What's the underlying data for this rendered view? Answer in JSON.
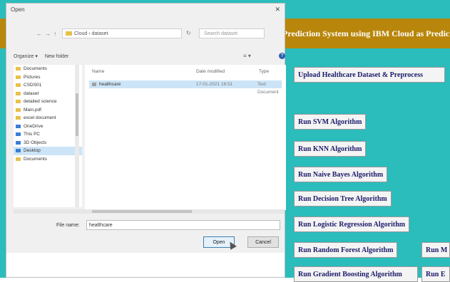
{
  "app": {
    "banner_title": "Prediction System using IBM Cloud as Prediction",
    "buttons": [
      "Upload Healthcare Dataset & Preprocess",
      "Run SVM Algorithm",
      "Run KNN Algorithm",
      "Run Naive Bayes Algorithm",
      "Run Decision Tree Algorithm",
      "Run Logistic Regression Algorithm",
      "Run Random Forest Algorithm",
      "Run Gradient Boosting Algorithm",
      "Run M",
      "Run E"
    ],
    "colors": {
      "banner": "#b8860b",
      "background": "#2bbcbc"
    }
  },
  "dialog": {
    "title": "Open",
    "close": "✕",
    "nav_back": "←",
    "nav_forward": "→",
    "nav_up": "↑",
    "address_path": "Cloud › dataset",
    "search_placeholder": "Search dataset",
    "toolbar": {
      "organize": "Organize ▾",
      "new_folder": "New folder"
    },
    "view_options": "≡ ▾",
    "help": "?",
    "nav_items": [
      {
        "label": "Documents",
        "icon": "folder-icon"
      },
      {
        "label": "Pictures",
        "icon": "folder-icon"
      },
      {
        "label": "CSDS01",
        "icon": "folder-icon"
      },
      {
        "label": "dataset",
        "icon": "folder-icon"
      },
      {
        "label": "detailed science",
        "icon": "folder-icon"
      },
      {
        "label": "Main.pdf",
        "icon": "folder-icon"
      },
      {
        "label": "excel document",
        "icon": "folder-icon"
      },
      {
        "label": "OneDrive",
        "icon": "cloud-icon"
      },
      {
        "label": "This PC",
        "icon": "pc-icon"
      },
      {
        "label": "3D Objects",
        "icon": "cube-icon"
      },
      {
        "label": "Desktop",
        "icon": "desktop-icon",
        "selected": true
      },
      {
        "label": "Documents",
        "icon": "folder-icon"
      }
    ],
    "columns": {
      "name": "Name",
      "date_modified": "Date modified",
      "type": "Type"
    },
    "files": [
      {
        "name": "healthcare",
        "date": "17-01-2021 16:51",
        "type": "Text Document"
      }
    ],
    "file_name_label": "File name:",
    "file_name_value": "healthcare",
    "open_button": "Open",
    "cancel_button": "Cancel"
  }
}
